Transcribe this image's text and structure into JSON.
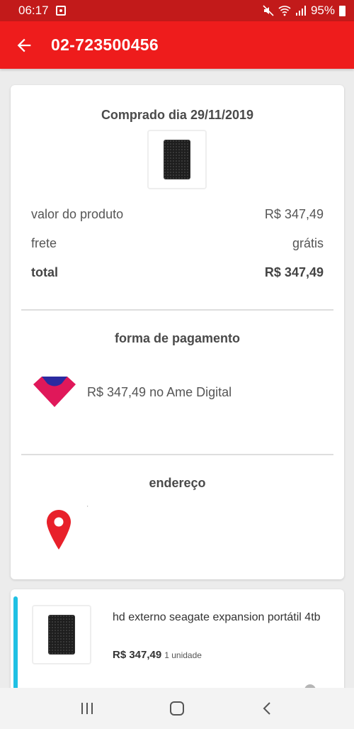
{
  "status_bar": {
    "time": "06:17",
    "battery": "95%"
  },
  "header": {
    "title": "02-723500456"
  },
  "order": {
    "purchased_label": "Comprado dia 29/11/2019",
    "rows": [
      {
        "label": "valor do produto",
        "value": "R$ 347,49"
      },
      {
        "label": "frete",
        "value": "grátis"
      },
      {
        "label": "total",
        "value": "R$ 347,49"
      }
    ]
  },
  "payment": {
    "title": "forma de pagamento",
    "text": "R$ 347,49 no Ame Digital"
  },
  "address": {
    "title": "endereço",
    "text": "'"
  },
  "item": {
    "name": "hd externo seagate expansion portátil 4tb",
    "price": "R$ 347,49",
    "quantity": "1 unidade"
  },
  "colors": {
    "status_bar": "#c21a1a",
    "app_bar": "#ee1c1c",
    "accent": "#1fc0e3",
    "pin": "#e8202a"
  },
  "icons": [
    "back-arrow-icon",
    "notification-icon",
    "mute-icon",
    "wifi-icon",
    "signal-icon",
    "battery-icon",
    "ame-logo-icon",
    "location-pin-icon",
    "recents-icon",
    "home-icon",
    "nav-back-icon"
  ]
}
